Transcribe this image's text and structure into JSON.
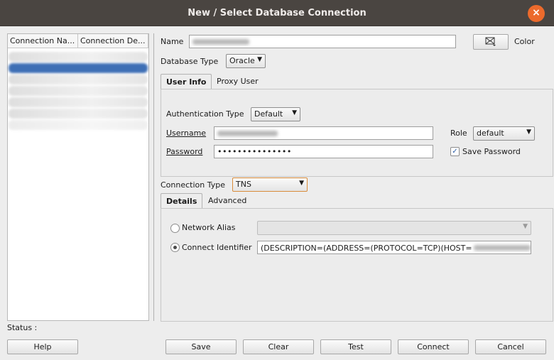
{
  "window": {
    "title": "New / Select Database Connection",
    "close_symbol": "×"
  },
  "connections": {
    "columns": [
      "Connection Na...",
      "Connection De..."
    ],
    "rows": 6,
    "selected_index": 1
  },
  "form": {
    "name_label": "Name",
    "color_label": "Color",
    "db_type_label": "Database Type",
    "db_type_value": "Oracle",
    "tabs_user": [
      "User Info",
      "Proxy User"
    ],
    "auth_type_label": "Authentication Type",
    "auth_type_value": "Default",
    "username_label": "Username",
    "password_label": "Password",
    "password_value": "•••••••••••••••",
    "role_label": "Role",
    "role_value": "default",
    "save_password_label": "Save Password",
    "save_password_checked": true,
    "conn_type_label": "Connection Type",
    "conn_type_value": "TNS",
    "tabs_details": [
      "Details",
      "Advanced"
    ],
    "network_alias_label": "Network Alias",
    "connect_identifier_label": "Connect Identifier",
    "connect_identifier_value": "(DESCRIPTION=(ADDRESS=(PROTOCOL=TCP)(HOST="
  },
  "status_label": "Status :",
  "buttons": {
    "help": "Help",
    "save": "Save",
    "clear": "Clear",
    "test": "Test",
    "connect": "Connect",
    "cancel": "Cancel"
  },
  "colors": {
    "titlebar": "#4a4541",
    "close": "#ec6a2c",
    "selection": "#3e6fb5"
  }
}
